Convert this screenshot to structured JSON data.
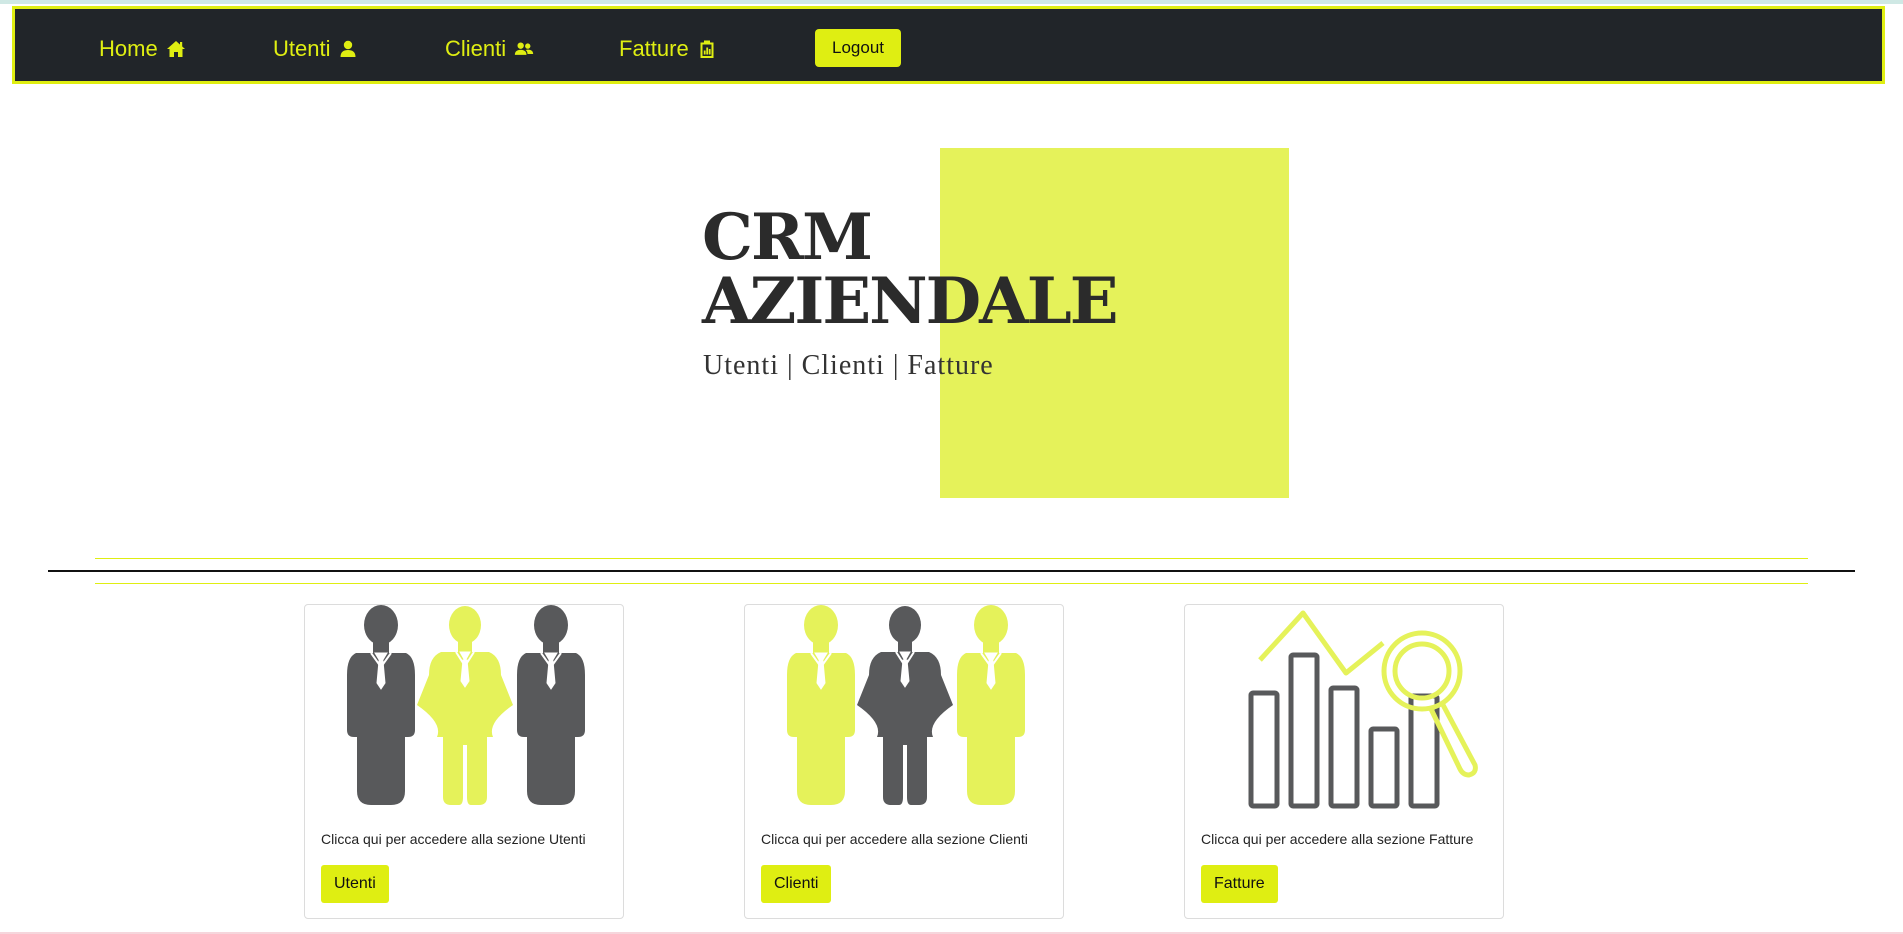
{
  "navbar": {
    "items": [
      {
        "label": "Home",
        "icon": "home-icon"
      },
      {
        "label": "Utenti",
        "icon": "user-icon"
      },
      {
        "label": "Clienti",
        "icon": "users-icon"
      },
      {
        "label": "Fatture",
        "icon": "clipboard-chart-icon"
      }
    ],
    "logout_label": "Logout"
  },
  "hero": {
    "title_line1": "CRM",
    "title_line2": "AZIENDALE",
    "subtitle": "Utenti | Clienti | Fatture"
  },
  "cards": [
    {
      "image": "team-users-illustration",
      "text": "Clicca qui per accedere alla sezione Utenti",
      "button": "Utenti"
    },
    {
      "image": "team-clients-illustration",
      "text": "Clicca qui per accedere alla sezione Clienti",
      "button": "Clienti"
    },
    {
      "image": "invoice-analytics-illustration",
      "text": "Clicca qui per accedere alla sezione Fatture",
      "button": "Fatture"
    }
  ],
  "colors": {
    "accent": "#dfee12",
    "hero_square": "#e5f25a",
    "navbar_bg": "#212529",
    "figure_dark": "#58595b",
    "figure_light": "#e5f25a"
  }
}
